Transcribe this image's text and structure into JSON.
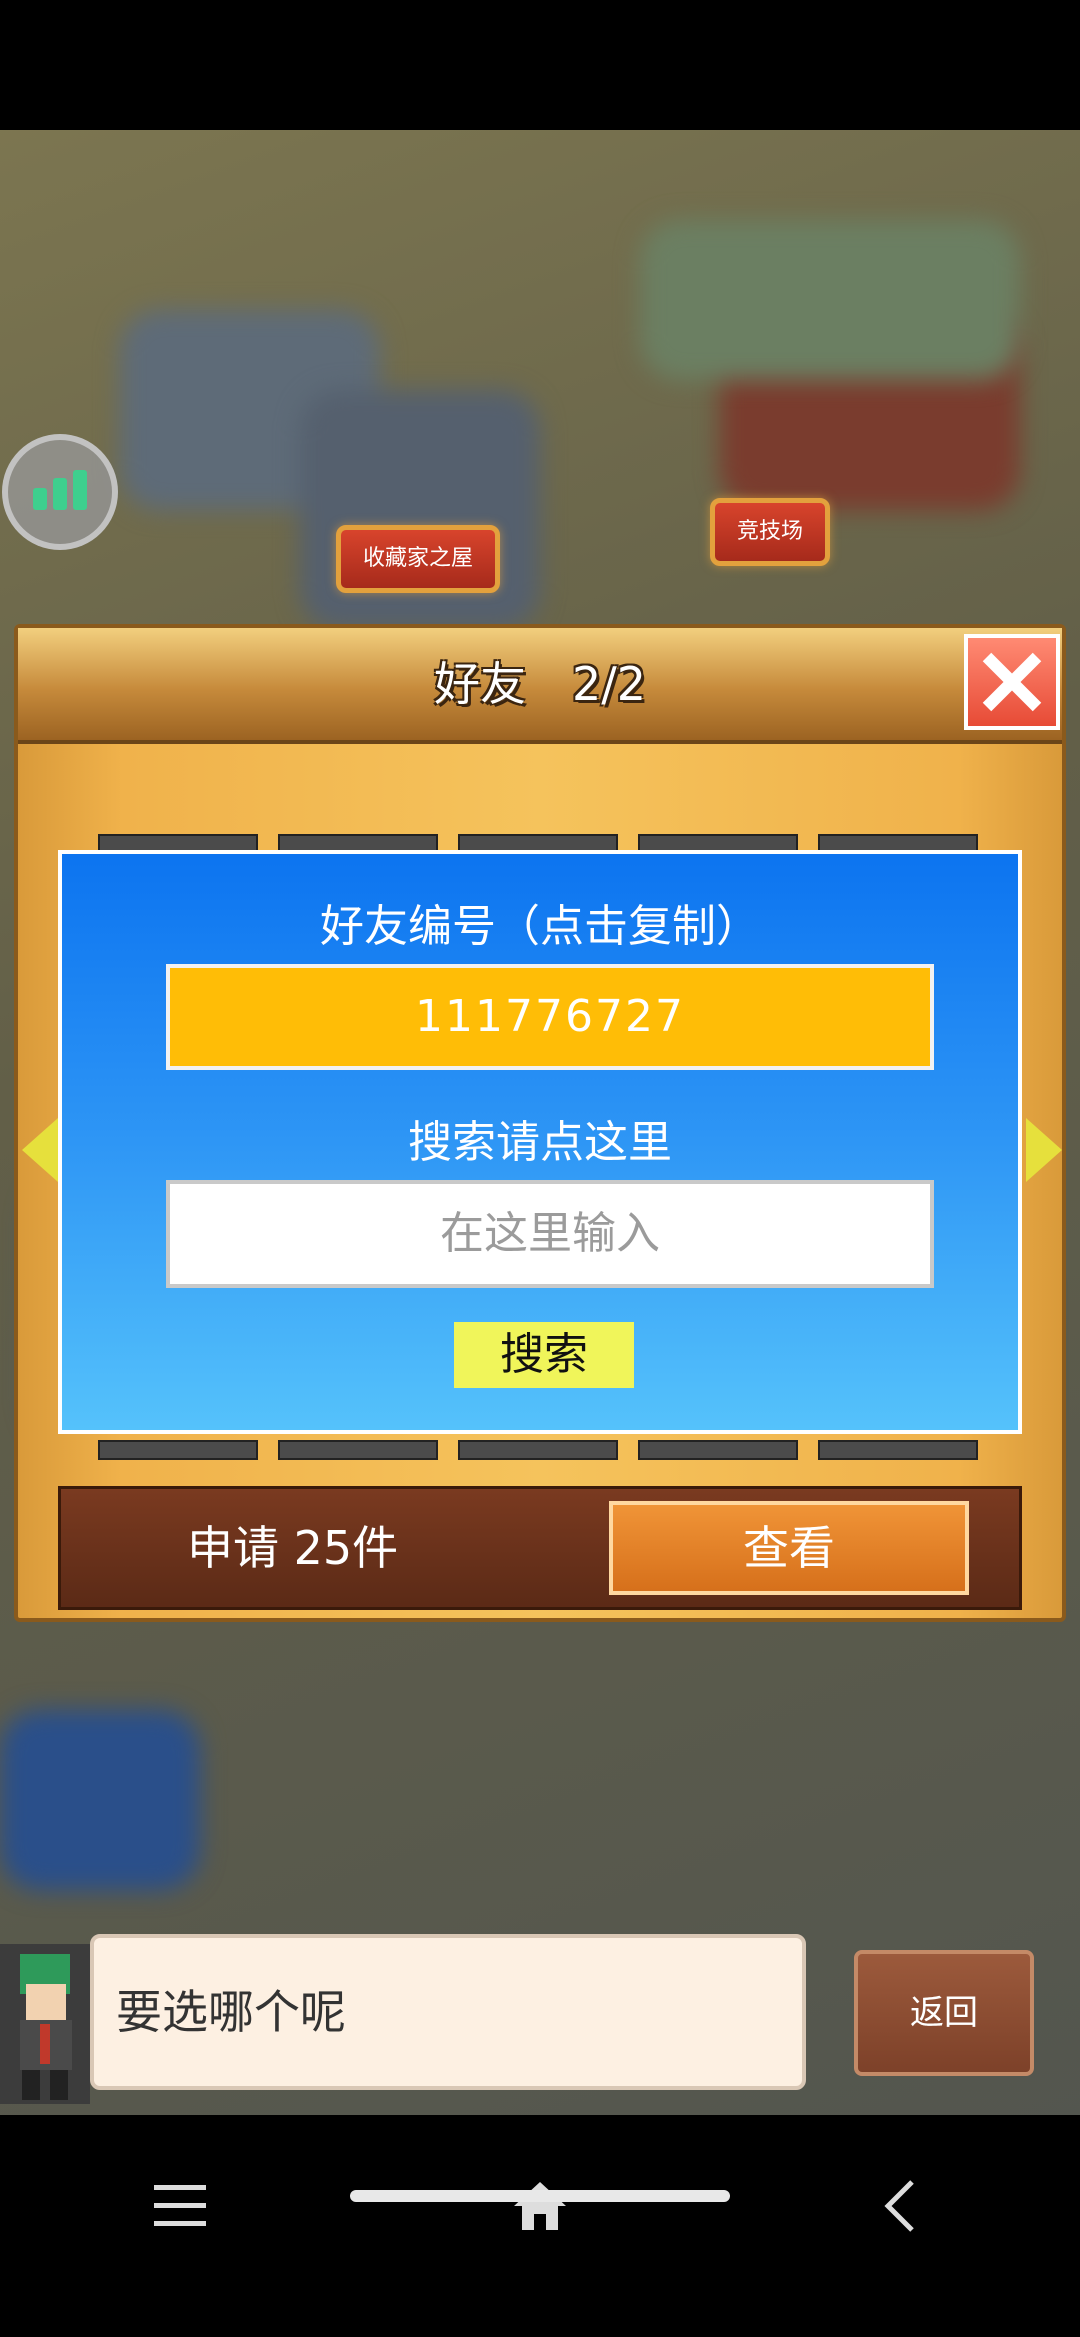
{
  "map": {
    "label_collectors_house": "收藏家之屋",
    "label_arena": "竞技场"
  },
  "panel": {
    "title": "好友　2/2",
    "friend_id_label": "好友编号（点击复制）",
    "friend_id": "111776727",
    "search_label": "搜索请点这里",
    "search_placeholder": "在这里输入",
    "search_button": "搜索",
    "requests_label": "申请 25件",
    "view_button": "查看"
  },
  "dialog": {
    "speech": "要选哪个呢",
    "back_button": "返回"
  },
  "colors": {
    "card_blue": "#0c74f0",
    "id_box_yellow": "#ffbd06",
    "search_button_yellow": "#f0f55a",
    "view_button_orange": "#f09437",
    "close_red": "#e74b36"
  }
}
